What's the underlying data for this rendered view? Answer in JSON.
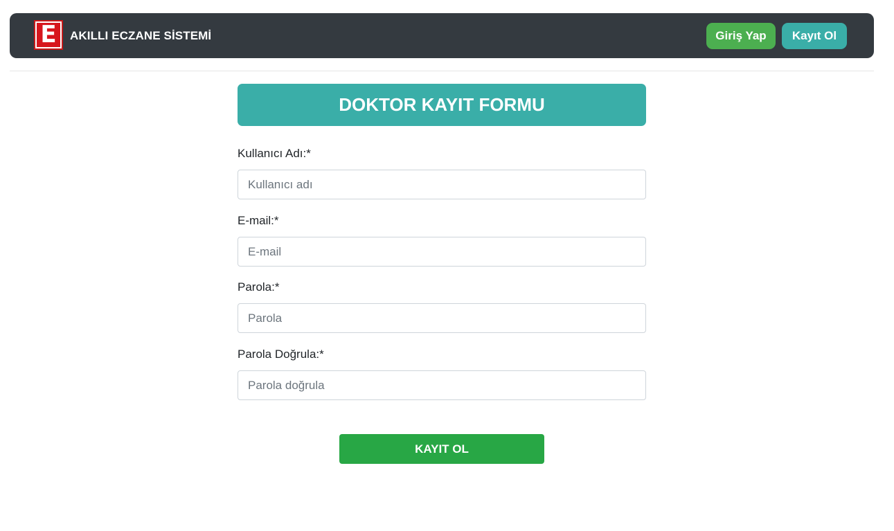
{
  "navbar": {
    "logo_letter": "E",
    "brand_title": "AKILLI ECZANE SİSTEMİ",
    "login_label": "Giriş Yap",
    "register_label": "Kayıt Ol"
  },
  "form": {
    "title": "DOKTOR KAYIT FORMU",
    "fields": [
      {
        "label": "Kullanıcı Adı:*",
        "placeholder": "Kullanıcı adı",
        "value": ""
      },
      {
        "label": "E-mail:*",
        "placeholder": "E-mail",
        "value": ""
      },
      {
        "label": "Parola:*",
        "placeholder": "Parola",
        "value": ""
      },
      {
        "label": "Parola Doğrula:*",
        "placeholder": "Parola doğrula",
        "value": ""
      }
    ],
    "submit_label": "KAYIT OL"
  },
  "colors": {
    "navbar_bg": "#343a40",
    "login_button": "#4caf50",
    "register_button": "#3aaea8",
    "header_bg": "#3aaea8",
    "submit_button": "#28a745",
    "logo_red": "#d7161d"
  },
  "icons": {
    "logo": "pharmacy-e-logo"
  }
}
